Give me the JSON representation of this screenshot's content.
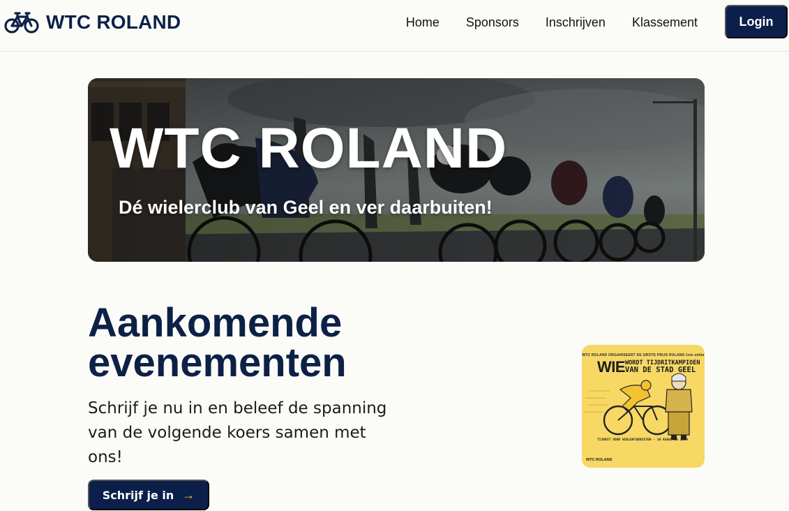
{
  "brand": {
    "name": "WTC ROLAND",
    "icon": "bicycle-icon"
  },
  "nav": {
    "links": [
      "Home",
      "Sponsors",
      "Inschrijven",
      "Klassement"
    ],
    "login_label": "Login"
  },
  "hero": {
    "title": "WTC ROLAND",
    "subtitle": "Dé wielerclub van Geel en ver daarbuiten!"
  },
  "events": {
    "title": "Aankomende evenementen",
    "description": "Schrijf je nu in en beleef de spanning van de volgende koers samen met ons!",
    "cta_label": "Schrijf je in",
    "cta_icon": "arrow-right-icon"
  },
  "poster": {
    "top_line": "WTC ROLAND ORGANISEERT DE GROTE PRIJS ROLAND 1ste editie",
    "wie": "WIE",
    "headline_1": "WORDT TIJDRITKAMPIOEN",
    "headline_2": "VAN DE STAD GEEL",
    "bottom_line": "TIJDRIT VOOR WIELERTOERISTEN - 19 AUGUSTUS 2024",
    "logo": "WTC ROLAND"
  },
  "colors": {
    "navy": "#0b1f4a",
    "accent": "#f4c21d",
    "background": "#fbfcf8",
    "poster": "#f7d865"
  }
}
